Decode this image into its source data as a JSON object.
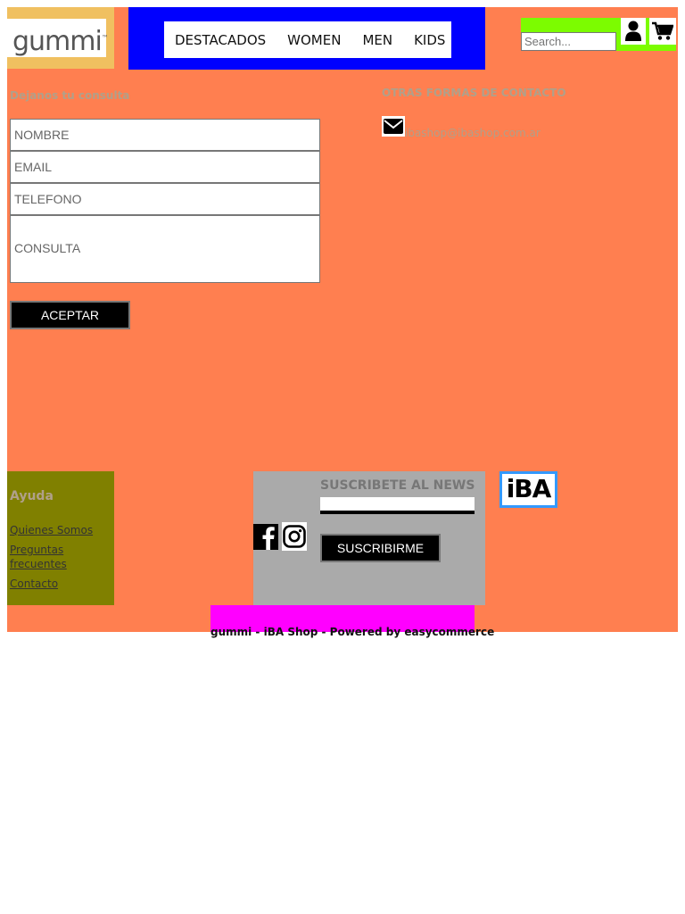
{
  "header": {
    "logo_text": "gummi",
    "logo_mark": "™",
    "nav": [
      "DESTACADOS",
      "WOMEN",
      "MEN",
      "KIDS"
    ],
    "search_placeholder": "Search...",
    "user_icon": "user-icon",
    "cart_icon": "cart-icon"
  },
  "contact": {
    "form_title": "Dejanos tu consulta",
    "name_placeholder": "NOMBRE",
    "email_placeholder": "EMAIL",
    "phone_placeholder": "TELEFONO",
    "query_placeholder": "CONSULTA",
    "submit_label": "ACEPTAR",
    "other_title": "OTRAS FORMAS DE CONTACTO",
    "email_address": "ibashop@ibashop.com.ar",
    "mail_icon": "envelope-icon"
  },
  "footer": {
    "help_title": "Ayuda",
    "help_links": [
      "Quienes Somos",
      "Preguntas frecuentes",
      "Contacto"
    ],
    "newsletter_title": "SUSCRIBETE AL NEWS",
    "subscribe_label": "SUSCRIBIRME",
    "social_icons": [
      "facebook-icon",
      "instagram-icon"
    ],
    "partner_logo": "iBA",
    "credit": "gummi - iBA Shop - Powered by easycommerce"
  },
  "colors": {
    "page_bg": "#ff7f50",
    "logo_bg": "#f0c060",
    "nav_bg": "#0000ff",
    "tools_bg": "#7cfc00",
    "help_bg": "#808000",
    "news_bg": "#aaaaaa",
    "credit_bg": "#ff00ff",
    "button_bg": "#000000"
  }
}
